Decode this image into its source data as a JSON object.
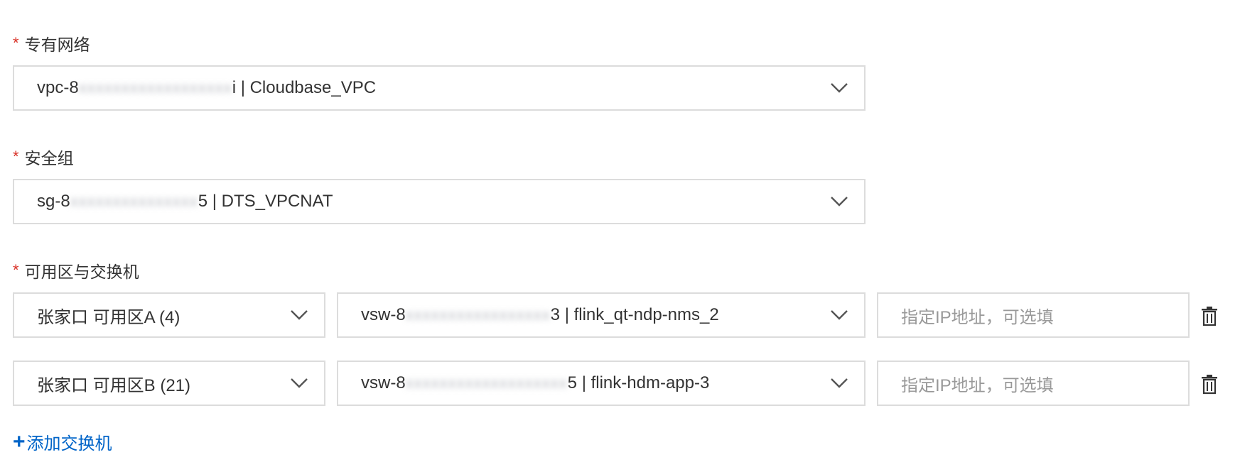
{
  "vpc": {
    "label": "专有网络",
    "value_prefix": "vpc-8",
    "value_suffix": "i | Cloudbase_VPC"
  },
  "security_group": {
    "label": "安全组",
    "value_prefix": "sg-8",
    "value_suffix": "5 | DTS_VPCNAT"
  },
  "zones": {
    "label": "可用区与交换机",
    "rows": [
      {
        "zone": "张家口 可用区A (4)",
        "vswitch_prefix": "vsw-8",
        "vswitch_suffix": "3 | flink_qt-ndp-nms_2",
        "ip_placeholder": "指定IP地址，可选填"
      },
      {
        "zone": "张家口 可用区B (21)",
        "vswitch_prefix": "vsw-8",
        "vswitch_suffix": "5 | flink-hdm-app-3",
        "ip_placeholder": "指定IP地址，可选填"
      }
    ]
  },
  "add_vswitch": {
    "icon": "plus-icon",
    "label": "添加交换机"
  },
  "colors": {
    "required": "#d93026",
    "link": "#0064c8",
    "border": "#dcdcdc",
    "text": "#333333",
    "placeholder": "#999999"
  }
}
